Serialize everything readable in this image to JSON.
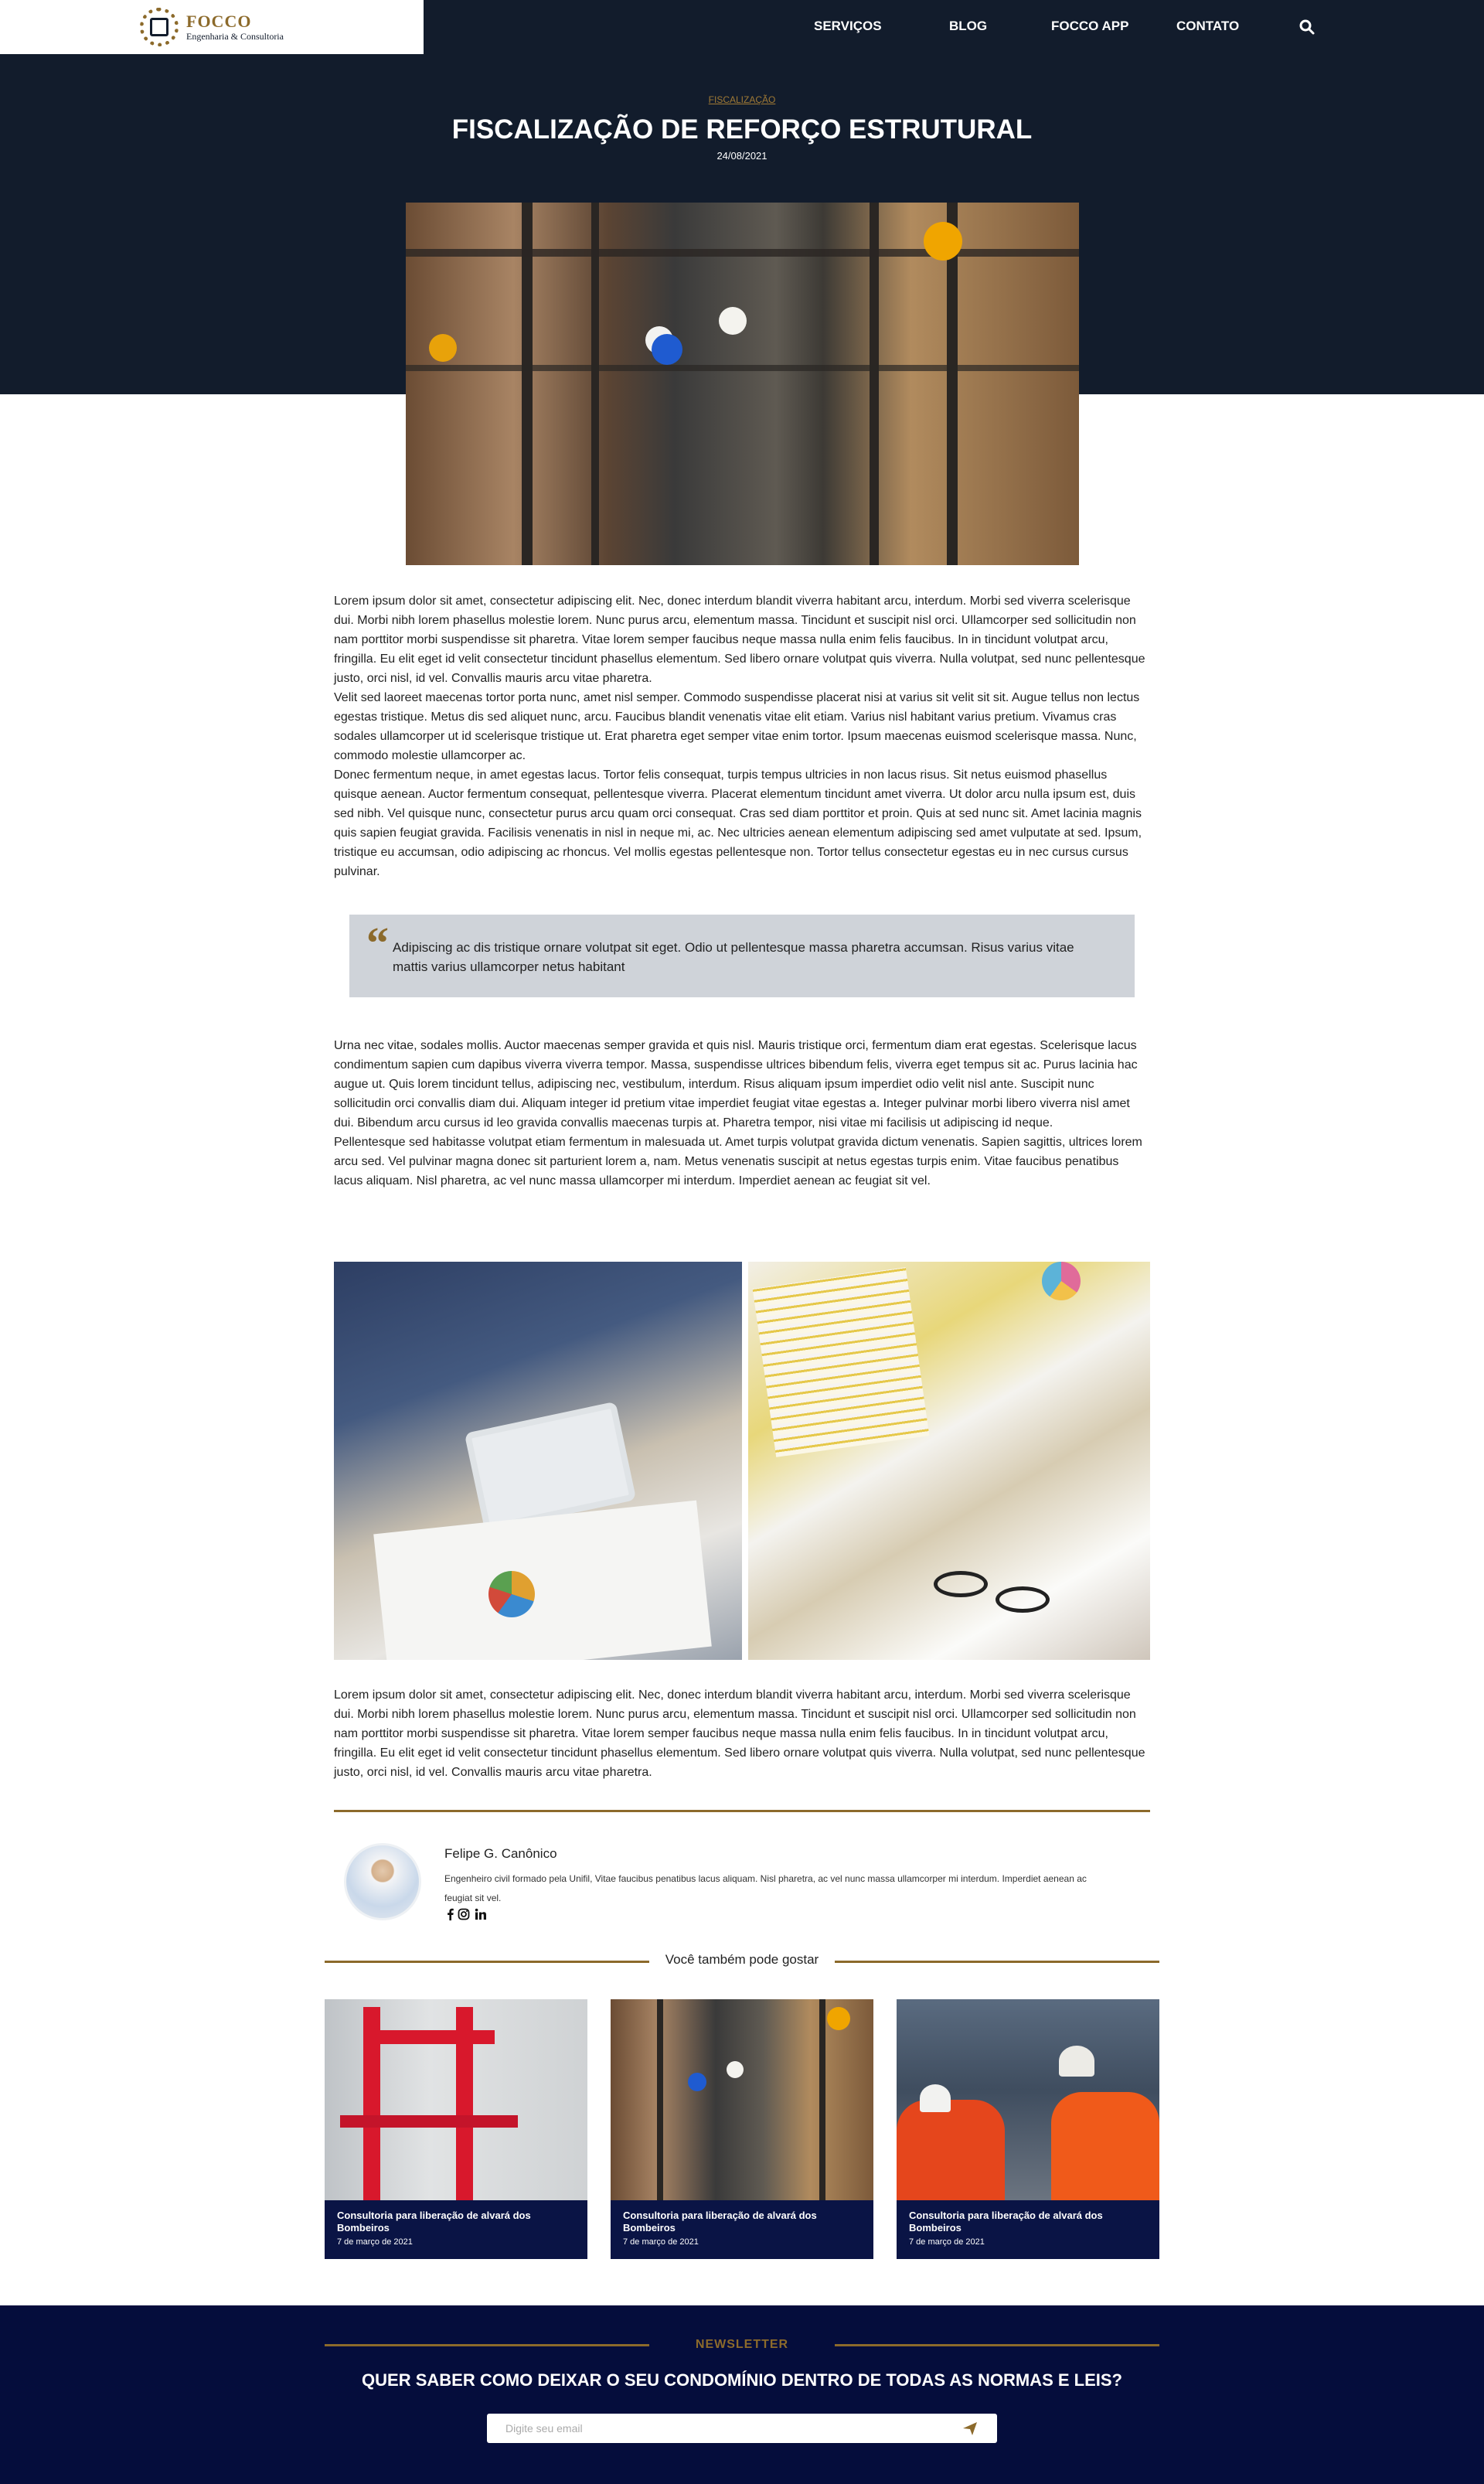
{
  "logo": {
    "name": "FOCCO",
    "tagline": "Engenharia & Consultoria"
  },
  "nav": {
    "items": [
      "SERVIÇOS",
      "BLOG",
      "FOCCO APP",
      "CONTATO"
    ]
  },
  "post": {
    "category": "FISCALIZAÇÃO",
    "title": "FISCALIZAÇÃO DE REFORÇO ESTRUTURAL",
    "date": "24/08/2021"
  },
  "article": {
    "intro": [
      "Lorem ipsum dolor sit amet, consectetur adipiscing elit. Nec, donec interdum blandit viverra habitant arcu, interdum. Morbi sed viverra scelerisque dui. Morbi nibh lorem phasellus molestie lorem. Nunc purus arcu, elementum massa. Tincidunt et suscipit nisl orci. Ullamcorper sed sollicitudin non nam porttitor morbi suspendisse sit pharetra. Vitae lorem semper faucibus neque massa nulla enim felis faucibus. In in tincidunt volutpat arcu, fringilla. Eu elit eget id velit consectetur tincidunt phasellus elementum. Sed libero ornare volutpat quis viverra. Nulla volutpat, sed nunc pellentesque justo, orci nisl, id vel. Convallis mauris arcu vitae pharetra.",
      "Velit sed laoreet maecenas tortor porta nunc, amet nisl semper. Commodo suspendisse placerat nisi at varius sit velit sit sit. Augue tellus non lectus egestas tristique. Metus dis sed aliquet nunc, arcu. Faucibus blandit venenatis vitae elit etiam. Varius nisl habitant varius pretium. Vivamus cras sodales ullamcorper ut id scelerisque tristique ut. Erat pharetra eget semper vitae enim tortor. Ipsum maecenas euismod scelerisque massa. Nunc, commodo molestie ullamcorper ac.",
      "Donec fermentum neque, in amet egestas lacus. Tortor felis consequat, turpis tempus ultricies in non lacus risus. Sit netus euismod phasellus quisque aenean. Auctor fermentum consequat, pellentesque viverra. Placerat elementum tincidunt amet viverra. Ut dolor arcu nulla ipsum est, duis sed nibh. Vel quisque nunc, consectetur purus arcu quam orci consequat. Cras sed diam porttitor et proin. Quis at sed nunc sit. Amet lacinia magnis quis sapien feugiat gravida. Facilisis venenatis in nisl in neque mi, ac. Nec ultricies aenean elementum adipiscing sed amet vulputate at sed. Ipsum, tristique eu accumsan, odio adipiscing ac rhoncus. Vel mollis egestas pellentesque non. Tortor tellus consectetur egestas eu in nec cursus cursus pulvinar."
    ],
    "quote": "Adipiscing ac dis tristique ornare volutpat sit eget. Odio ut pellentesque massa pharetra accumsan. Risus varius vitae mattis varius ullamcorper netus habitant",
    "middle": [
      "Urna nec vitae, sodales mollis. Auctor maecenas semper gravida et quis nisl. Mauris tristique orci, fermentum diam erat egestas. Scelerisque lacus condimentum sapien cum dapibus viverra viverra tempor. Massa, suspendisse ultrices bibendum felis, viverra eget tempus sit ac. Purus lacinia hac augue ut. Quis lorem tincidunt tellus, adipiscing nec, vestibulum, interdum. Risus aliquam ipsum imperdiet odio velit nisl ante. Suscipit nunc sollicitudin orci convallis diam dui. Aliquam integer id pretium vitae imperdiet feugiat vitae egestas a. Integer pulvinar morbi libero viverra nisl amet dui. Bibendum arcu cursus id leo gravida convallis maecenas turpis at. Pharetra tempor, nisi vitae mi facilisis ut adipiscing id neque.",
      "Pellentesque sed habitasse volutpat etiam fermentum in malesuada ut. Amet turpis volutpat gravida dictum venenatis. Sapien sagittis, ultrices lorem arcu sed. Vel pulvinar magna donec sit parturient lorem a, nam. Metus venenatis suscipit at netus egestas turpis enim. Vitae faucibus penatibus lacus aliquam. Nisl pharetra, ac vel nunc massa ullamcorper mi interdum. Imperdiet aenean ac feugiat sit vel."
    ],
    "closing": "Lorem ipsum dolor sit amet, consectetur adipiscing elit. Nec, donec interdum blandit viverra habitant arcu, interdum. Morbi sed viverra scelerisque dui. Morbi nibh lorem phasellus molestie lorem. Nunc purus arcu, elementum massa. Tincidunt et suscipit nisl orci. Ullamcorper sed sollicitudin non nam porttitor morbi suspendisse sit pharetra. Vitae lorem semper faucibus neque massa nulla enim felis faucibus. In in tincidunt volutpat arcu, fringilla. Eu elit eget id velit consectetur tincidunt phasellus elementum. Sed libero ornare volutpat quis viverra. Nulla volutpat, sed nunc pellentesque justo, orci nisl, id vel. Convallis mauris arcu vitae pharetra."
  },
  "author": {
    "name": "Felipe G. Canônico",
    "bio": "Engenheiro civil formado pela Unifil, Vitae faucibus penatibus lacus aliquam. Nisl pharetra, ac vel nunc massa ullamcorper mi interdum. Imperdiet aenean ac feugiat sit vel.",
    "social_icons": [
      "facebook-icon",
      "instagram-icon",
      "linkedin-icon"
    ]
  },
  "related": {
    "heading": "Você também pode gostar",
    "cards": [
      {
        "title": "Consultoria para liberação de alvará dos Bombeiros",
        "date": "7 de março de 2021"
      },
      {
        "title": "Consultoria para liberação de alvará dos Bombeiros",
        "date": "7 de março de 2021"
      },
      {
        "title": "Consultoria para liberação de alvará dos Bombeiros",
        "date": "7 de março de 2021"
      }
    ]
  },
  "newsletter": {
    "label": "NEWSLETTER",
    "heading": "QUER SABER COMO DEIXAR O SEU CONDOMÍNIO DENTRO DE TODAS AS NORMAS E LEIS?",
    "email_placeholder": "Digite seu email"
  },
  "colors": {
    "navy": "#121c2c",
    "gold": "#8c6a2b",
    "newsletter_bg": "#050d3c",
    "card_caption_bg": "#0a1445",
    "quote_bg": "#cfd3d9"
  }
}
